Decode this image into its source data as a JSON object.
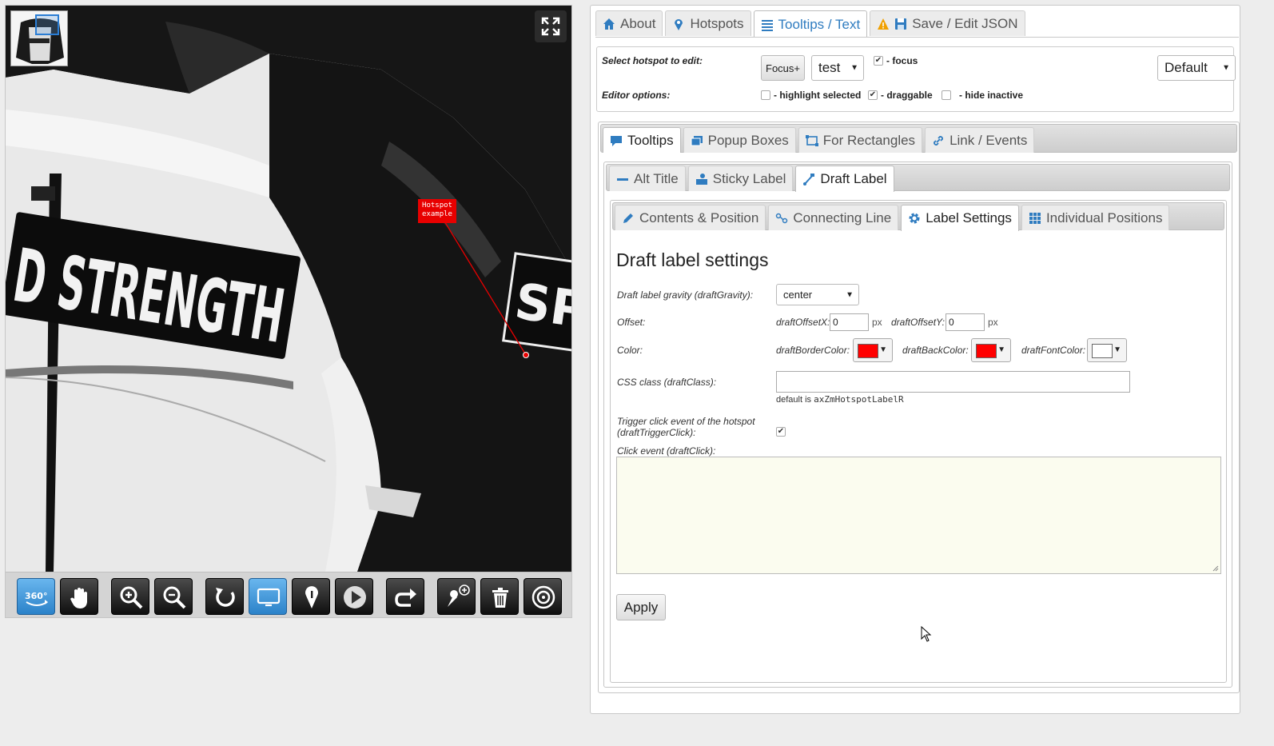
{
  "viewer": {
    "hotspot_label": "Hotspot example",
    "tools": [
      "360-rotate",
      "pan",
      "zoom-in",
      "zoom-out",
      "reset",
      "display-mode",
      "hotspot-info",
      "play",
      "redo",
      "add-hotspot",
      "delete",
      "spin"
    ]
  },
  "main_tabs": [
    {
      "label": "About",
      "active": false
    },
    {
      "label": "Hotspots",
      "active": false
    },
    {
      "label": "Tooltips / Text",
      "active": true
    },
    {
      "label": "Save / Edit JSON",
      "active": false
    }
  ],
  "options": {
    "select_hotspot_label": "Select hotspot to edit:",
    "focus_button": "Focus+",
    "hotspot_value": "test",
    "focus_checkbox": "- focus",
    "preset_value": "Default",
    "editor_options_label": "Editor options:",
    "highlight_selected": "- highlight selected",
    "draggable": "- draggable",
    "hide_inactive": "- hide inactive"
  },
  "tooltip_tabs": [
    {
      "label": "Tooltips",
      "active": true
    },
    {
      "label": "Popup Boxes",
      "active": false
    },
    {
      "label": "For Rectangles",
      "active": false
    },
    {
      "label": "Link / Events",
      "active": false
    }
  ],
  "label_tabs": [
    {
      "label": "Alt Title",
      "active": false
    },
    {
      "label": "Sticky Label",
      "active": false
    },
    {
      "label": "Draft Label",
      "active": true
    }
  ],
  "settings_tabs": [
    {
      "label": "Contents & Position",
      "active": false
    },
    {
      "label": "Connecting Line",
      "active": false
    },
    {
      "label": "Label Settings",
      "active": true
    },
    {
      "label": "Individual Positions",
      "active": false
    }
  ],
  "form": {
    "title": "Draft label settings",
    "gravity_label": "Draft label gravity (draftGravity):",
    "gravity_value": "center",
    "offset_label": "Offset:",
    "offset_x_label": "draftOffsetX:",
    "offset_x_value": "0",
    "offset_y_label": "draftOffsetY:",
    "offset_y_value": "0",
    "unit": "px",
    "color_label": "Color:",
    "border_color_label": "draftBorderColor:",
    "border_color": "#ff0000",
    "back_color_label": "draftBackColor:",
    "back_color": "#ff0000",
    "font_color_label": "draftFontColor:",
    "font_color": "#ffffff",
    "css_class_label": "CSS class (draftClass):",
    "css_class_value": "",
    "css_default_text": "default is",
    "css_default_value": "axZmHotspotLabelR",
    "trigger_label_line1": "Trigger click event of the hotspot",
    "trigger_label_line2": "(draftTriggerClick):",
    "click_event_label": "Click event (draftClick):",
    "apply_button": "Apply"
  },
  "colors": {
    "accent": "#2f7cc0",
    "hotspot": "#e80000"
  }
}
